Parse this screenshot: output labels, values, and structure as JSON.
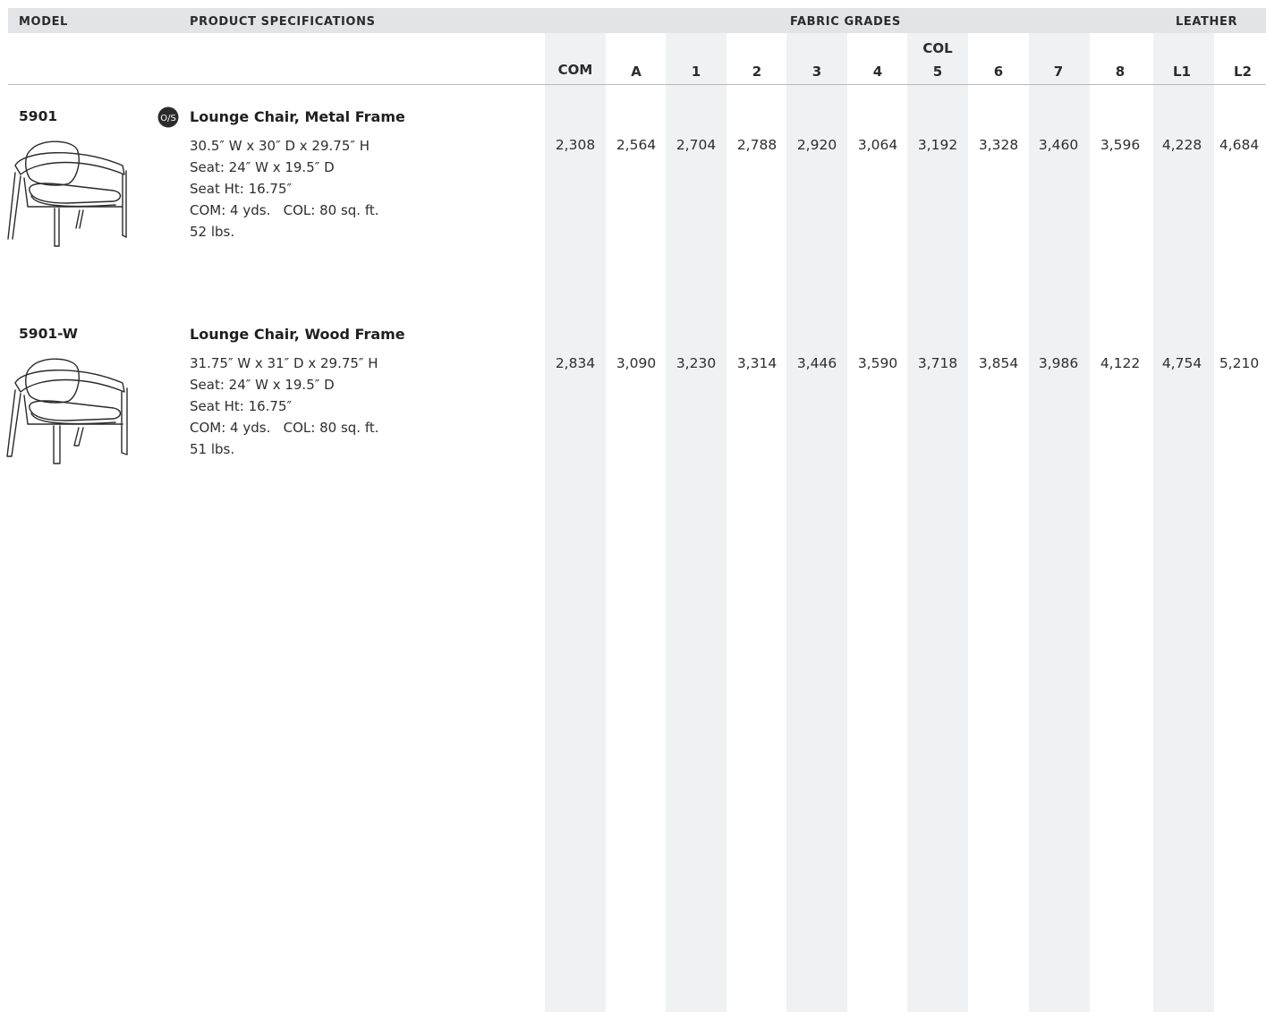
{
  "header": {
    "model": "MODEL",
    "product_specifications": "PRODUCT SPECIFICATIONS",
    "fabric_grades": "FABRIC GRADES",
    "leather": "LEATHER"
  },
  "columns": {
    "col_label": "COL",
    "labels": [
      "COM",
      "A",
      "1",
      "2",
      "3",
      "4",
      "5",
      "6",
      "7",
      "8",
      "L1",
      "L2"
    ]
  },
  "products": [
    {
      "model": "5901",
      "name": "Lounge Chair, Metal Frame",
      "badge_icon": "outdoor-os-badge-icon",
      "specs": [
        "30.5″ W x 30″ D x 29.75″ H",
        "Seat: 24″ W x 19.5″ D",
        "Seat Ht: 16.75″",
        "COM: 4 yds.   COL: 80 sq. ft.",
        "52 lbs."
      ],
      "prices": [
        "2,308",
        "2,564",
        "2,704",
        "2,788",
        "2,920",
        "3,064",
        "3,192",
        "3,328",
        "3,460",
        "3,596",
        "4,228",
        "4,684"
      ]
    },
    {
      "model": "5901-W",
      "name": "Lounge Chair, Wood Frame",
      "specs": [
        "31.75″ W x 31″ D x 29.75″ H",
        "Seat: 24″ W x 19.5″ D",
        "Seat Ht: 16.75″",
        "COM: 4 yds.   COL: 80 sq. ft.",
        "51 lbs."
      ],
      "prices": [
        "2,834",
        "3,090",
        "3,230",
        "3,314",
        "3,446",
        "3,590",
        "3,718",
        "3,854",
        "3,986",
        "4,122",
        "4,754",
        "5,210"
      ]
    }
  ],
  "colors": {
    "stripe": "#f0f1f3",
    "header_band": "#e3e4e6",
    "rule": "#b9b9b9"
  }
}
